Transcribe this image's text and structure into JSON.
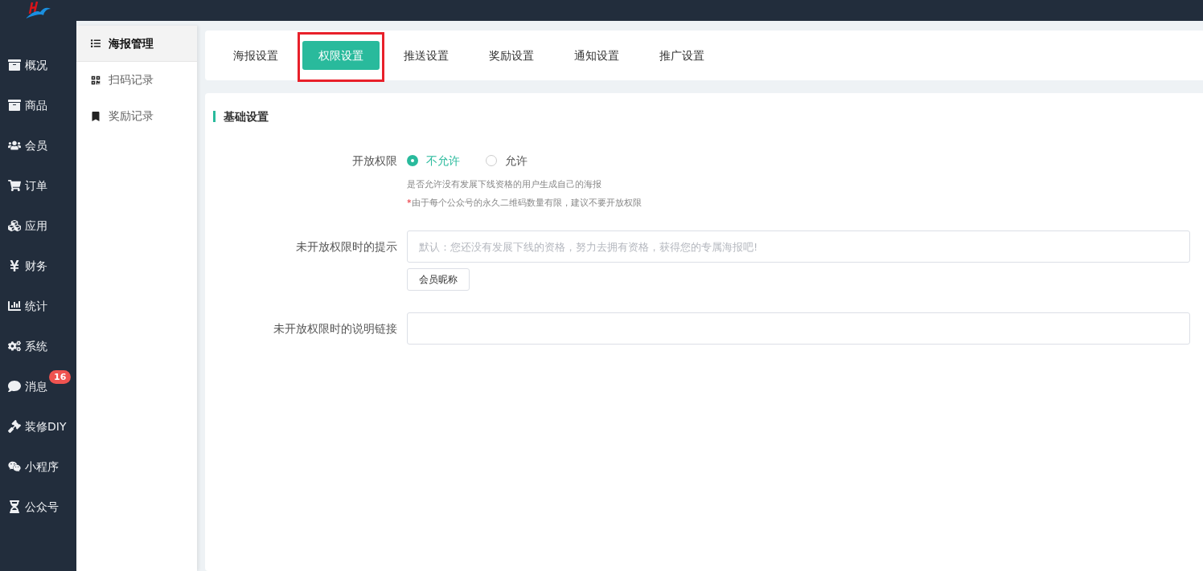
{
  "main_nav": [
    {
      "label": "概况"
    },
    {
      "label": "商品"
    },
    {
      "label": "会员"
    },
    {
      "label": "订单"
    },
    {
      "label": "应用"
    },
    {
      "label": "财务"
    },
    {
      "label": "统计"
    },
    {
      "label": "系统"
    },
    {
      "label": "消息",
      "badge": "16"
    },
    {
      "label": "装修DIY"
    },
    {
      "label": "小程序"
    },
    {
      "label": "公众号"
    }
  ],
  "sub_nav": [
    {
      "label": "海报管理",
      "selected": true
    },
    {
      "label": "扫码记录",
      "selected": false
    },
    {
      "label": "奖励记录",
      "selected": false
    }
  ],
  "tabs": [
    {
      "label": "海报设置",
      "selected": false,
      "highlighted": false
    },
    {
      "label": "权限设置",
      "selected": true,
      "highlighted": true
    },
    {
      "label": "推送设置",
      "selected": false,
      "highlighted": false
    },
    {
      "label": "奖励设置",
      "selected": false,
      "highlighted": false
    },
    {
      "label": "通知设置",
      "selected": false,
      "highlighted": false
    },
    {
      "label": "推广设置",
      "selected": false,
      "highlighted": false
    }
  ],
  "section_title": "基础设置",
  "open_permission": {
    "label": "开放权限",
    "options": [
      {
        "label": "不允许",
        "selected": true
      },
      {
        "label": "允许",
        "selected": false
      }
    ],
    "help": "是否允许没有发展下线资格的用户生成自己的海报",
    "note_mark": "*",
    "note": "由于每个公众号的永久二维码数量有限，建议不要开放权限"
  },
  "tip_field": {
    "label": "未开放权限时的提示",
    "placeholder": "默认：您还没有发展下线的资格，努力去拥有资格，获得您的专属海报吧!",
    "insert_button": "会员昵称"
  },
  "link_field": {
    "label": "未开放权限时的说明链接"
  }
}
